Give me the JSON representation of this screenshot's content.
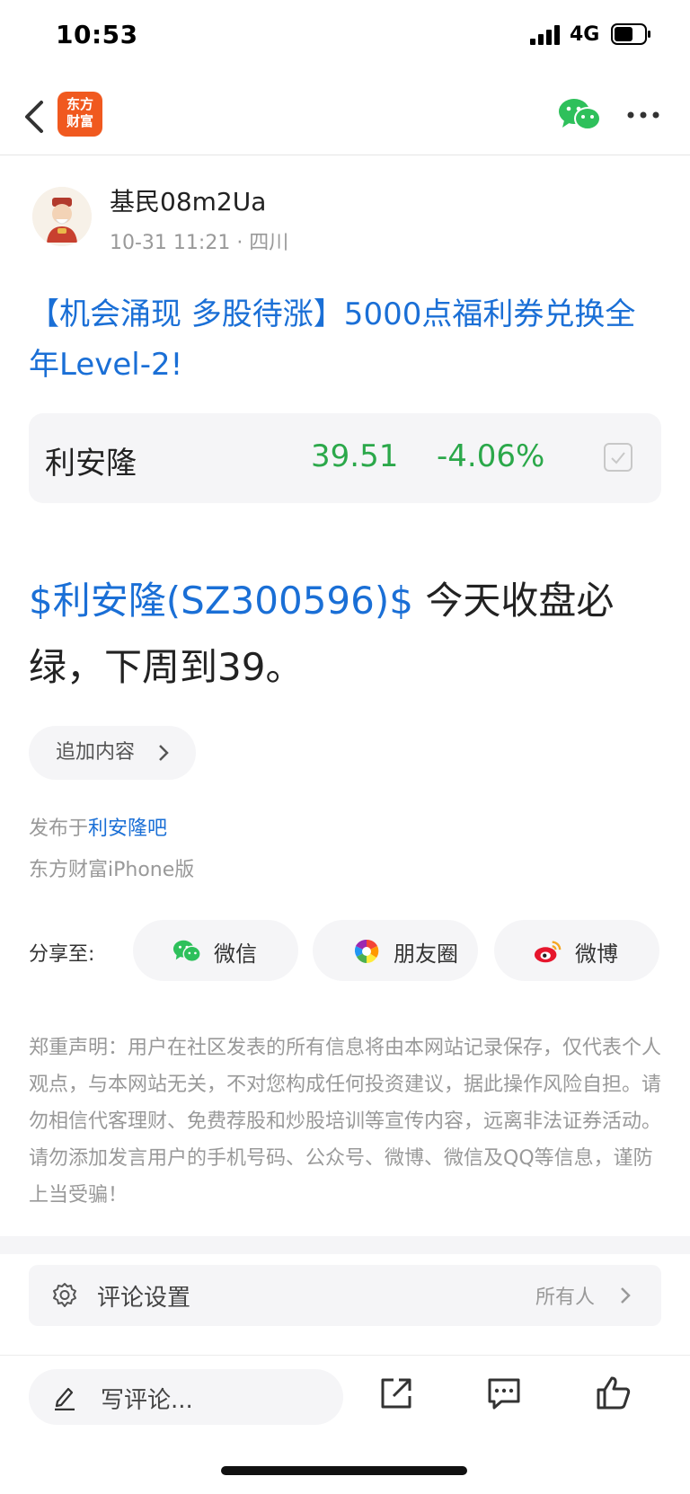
{
  "status": {
    "time": "10:53",
    "network": "4G"
  },
  "nav": {
    "logo_line1": "东方",
    "logo_line2": "财富"
  },
  "post": {
    "username": "基民08m2Ua",
    "meta": "10-31 11:21  · 四川",
    "title": "【机会涌现 多股待涨】5000点福利券兑换全年Level-2!",
    "stock": {
      "name": "利安隆",
      "price": "39.51",
      "change": "-4.06%"
    },
    "body_link": "$利安隆(SZ300596)$",
    "body_text": "  今天收盘必绿，下周到39。",
    "append_label": "追加内容",
    "published_prefix": "发布于",
    "published_bar": "利安隆吧",
    "client": "东方财富iPhone版"
  },
  "share": {
    "label": "分享至:",
    "wechat": "微信",
    "moments": "朋友圈",
    "weibo": "微博"
  },
  "disclaimer": "郑重声明：用户在社区发表的所有信息将由本网站记录保存，仅代表个人观点，与本网站无关，不对您构成任何投资建议，据此操作风险自担。请勿相信代客理财、免费荐股和炒股培训等宣传内容，远离非法证券活动。请勿添加发言用户的手机号码、公众号、微博、微信及QQ等信息，谨防上当受骗！",
  "comment_setting": {
    "label": "评论设置",
    "value": "所有人"
  },
  "bottom": {
    "write_placeholder": "写评论..."
  },
  "colors": {
    "link": "#1a6fd6",
    "down": "#2ba84a",
    "brand": "#f0591f"
  }
}
